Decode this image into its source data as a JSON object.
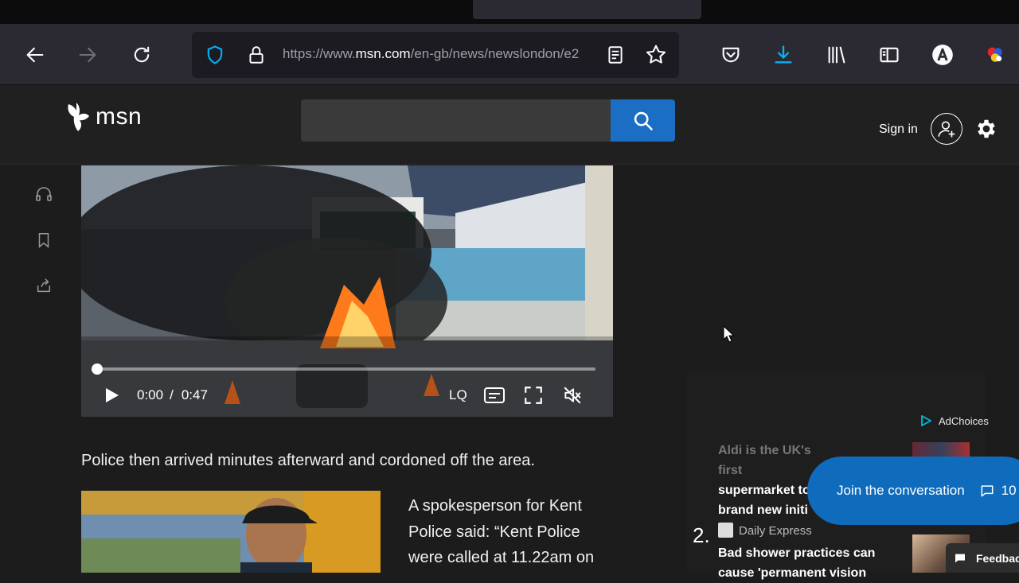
{
  "browser": {
    "url_prefix": "https://www.",
    "url_domain": "msn.com",
    "url_path": "/en-gb/news/newslondon/e2",
    "accent": "#0090ed"
  },
  "header": {
    "logo_text": "msn",
    "search_placeholder": "",
    "signin_label": "Sign in"
  },
  "video": {
    "current_time": "0:00",
    "separator": "/",
    "duration": "0:47",
    "quality_label": "LQ",
    "progress_fraction": 0.0
  },
  "article": {
    "paragraph": "Police then arrived minutes afterward and cordoned off the area.",
    "quote_lines": [
      "A spokesperson for Kent",
      "Police said: “Kent Police",
      "were called at 11.22am on"
    ]
  },
  "sidebar_right": {
    "adchoices_label": "AdChoices",
    "story1": {
      "faded_line": "Aldi is the UK's first",
      "title_lines": [
        "supermarket to i",
        "brand new initi"
      ]
    },
    "story2": {
      "rank": "2.",
      "source": "Daily Express",
      "title_lines": [
        "Bad shower practices can",
        "cause 'permanent vision"
      ]
    }
  },
  "join": {
    "label": "Join the conversation",
    "count": "10"
  },
  "feedback": {
    "label": "Feedback"
  }
}
